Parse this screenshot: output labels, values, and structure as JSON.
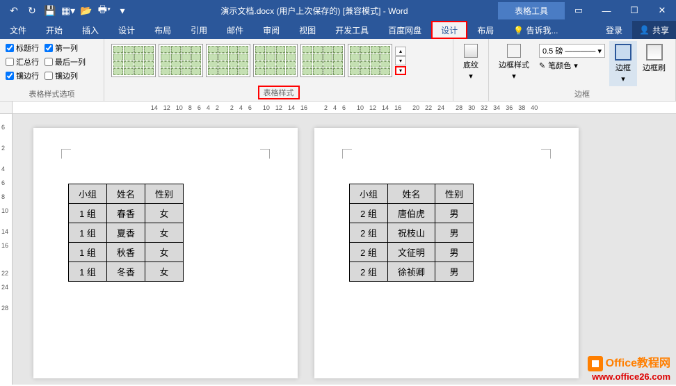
{
  "titlebar": {
    "title": "演示文档.docx (用户上次保存的) [兼容模式] - Word",
    "context_tab": "表格工具"
  },
  "tabs": {
    "file": "文件",
    "home": "开始",
    "insert": "插入",
    "design_doc": "设计",
    "layout_doc": "布局",
    "ref": "引用",
    "mail": "邮件",
    "review": "审阅",
    "view": "视图",
    "dev": "开发工具",
    "baidu": "百度网盘",
    "design": "设计",
    "layout": "布局",
    "tell": "告诉我...",
    "login": "登录",
    "share": "共享"
  },
  "style_opts": {
    "header_row": "标题行",
    "first_col": "第一列",
    "total_row": "汇总行",
    "last_col": "最后一列",
    "banded_row": "镶边行",
    "banded_col": "镶边列",
    "group_label": "表格样式选项"
  },
  "groups": {
    "styles": "表格样式",
    "shading": "底纹",
    "border_style": "边框样式",
    "borders": "边框",
    "border_btn": "边框",
    "painter": "边框刷"
  },
  "border": {
    "weight": "0.5 磅",
    "pen_color": "笔颜色"
  },
  "ruler_h": [
    "14",
    "12",
    "10",
    "8",
    "6",
    "4",
    "2",
    "",
    "2",
    "4",
    "6",
    "",
    "10",
    "12",
    "14",
    "16",
    "",
    "",
    "2",
    "4",
    "6",
    "",
    "10",
    "12",
    "14",
    "16",
    "",
    "20",
    "22",
    "24",
    "",
    "28",
    "30",
    "32",
    "34",
    "36",
    "38",
    "40"
  ],
  "ruler_v": [
    "",
    "6",
    "",
    "2",
    "",
    "4",
    "6",
    "8",
    "10",
    "",
    "14",
    "16",
    "",
    "",
    "22",
    "24",
    "",
    "28"
  ],
  "table1": {
    "headers": [
      "小组",
      "姓名",
      "性别"
    ],
    "rows": [
      [
        "1 组",
        "春香",
        "女"
      ],
      [
        "1 组",
        "夏香",
        "女"
      ],
      [
        "1 组",
        "秋香",
        "女"
      ],
      [
        "1 组",
        "冬香",
        "女"
      ]
    ]
  },
  "table2": {
    "headers": [
      "小组",
      "姓名",
      "性别"
    ],
    "rows": [
      [
        "2 组",
        "唐伯虎",
        "男"
      ],
      [
        "2 组",
        "祝枝山",
        "男"
      ],
      [
        "2 组",
        "文征明",
        "男"
      ],
      [
        "2 组",
        "徐祯卿",
        "男"
      ]
    ]
  },
  "watermark": {
    "line1": "Office教程网",
    "line2": "www.office26.com"
  }
}
